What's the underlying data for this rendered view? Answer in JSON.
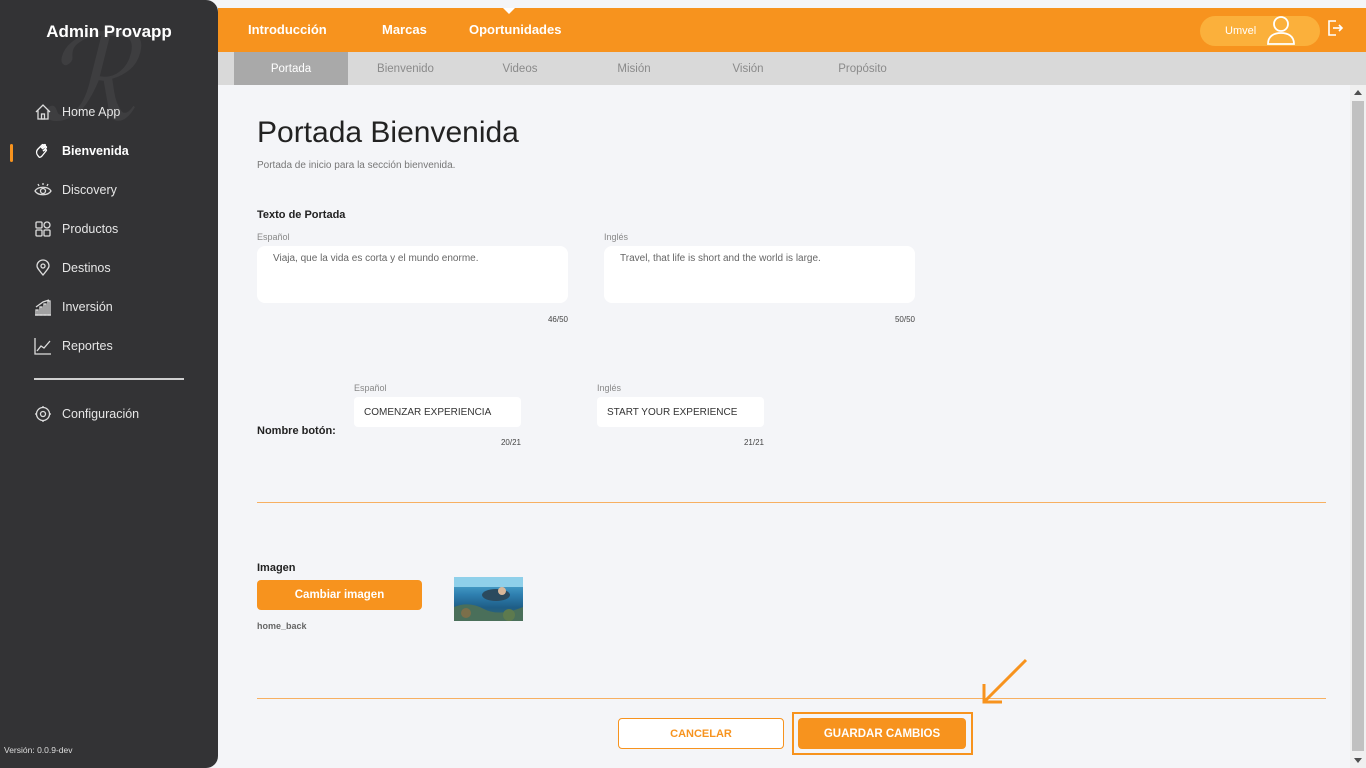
{
  "sidebar": {
    "app_title": "Admin Provapp",
    "items": [
      {
        "label": "Home App",
        "icon": "home-icon"
      },
      {
        "label": "Bienvenida",
        "icon": "waving-hand-icon",
        "active": true
      },
      {
        "label": "Discovery",
        "icon": "eye-icon"
      },
      {
        "label": "Productos",
        "icon": "grid-icon"
      },
      {
        "label": "Destinos",
        "icon": "location-pin-icon"
      },
      {
        "label": "Inversión",
        "icon": "bar-chart-icon"
      },
      {
        "label": "Reportes",
        "icon": "line-chart-icon"
      }
    ],
    "settings_label": "Configuración",
    "version": "Versión: 0.0.9-dev"
  },
  "topbar": {
    "tabs": [
      "Introducción",
      "Marcas",
      "Oportunidades"
    ],
    "active_tab": "Introducción",
    "user_name": "Umvel"
  },
  "subtabs": {
    "items": [
      "Portada",
      "Bienvenido",
      "Videos",
      "Misión",
      "Visión",
      "Propósito"
    ],
    "active": "Portada"
  },
  "page": {
    "title": "Portada Bienvenida",
    "subtitle": "Portada de inicio para la sección bienvenida."
  },
  "cover_text": {
    "label": "Texto de Portada",
    "es_label": "Español",
    "en_label": "Inglés",
    "es_value": "Viaja, que la vida es corta y el mundo enorme.",
    "en_value": "Travel, that life is short and the world is large.",
    "es_count": "46/50",
    "en_count": "50/50"
  },
  "button_name": {
    "label": "Nombre botón:",
    "es_label": "Español",
    "en_label": "Inglés",
    "es_value": "COMENZAR EXPERIENCIA",
    "en_value": "START YOUR EXPERIENCE",
    "es_count": "20/21",
    "en_count": "21/21"
  },
  "image": {
    "label": "Imagen",
    "change_button": "Cambiar imagen",
    "filename": "home_back"
  },
  "actions": {
    "cancel": "CANCELAR",
    "save": "GUARDAR CAMBIOS"
  },
  "colors": {
    "accent": "#f7931e",
    "sidebar_bg": "#333335"
  }
}
